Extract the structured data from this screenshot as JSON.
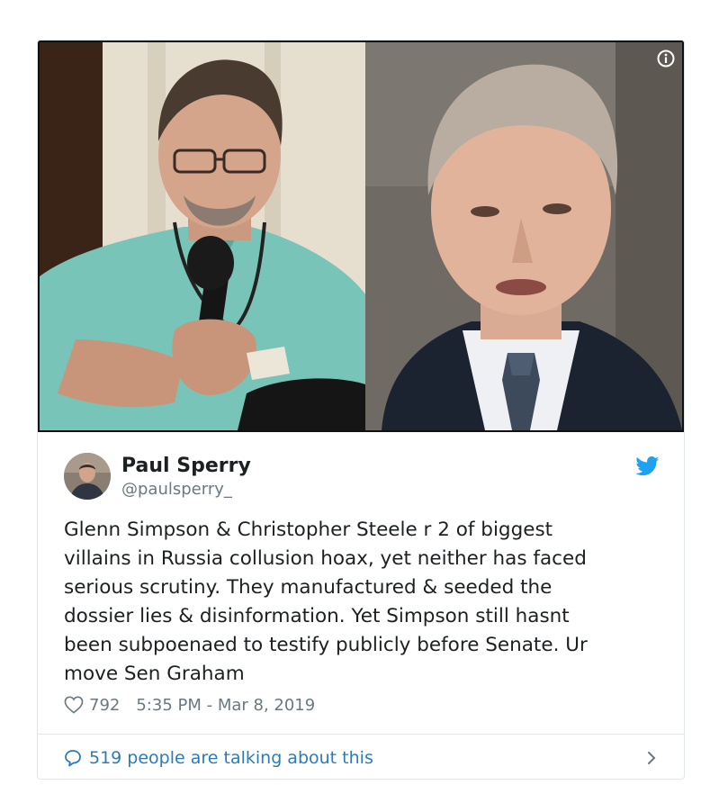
{
  "tweet": {
    "author_name": "Paul Sperry",
    "author_handle": "@paulsperry_",
    "text": "Glenn Simpson & Christopher Steele r 2 of biggest\nvillains in Russia collusion hoax, yet neither has faced\nserious scrutiny. They manufactured & seeded the\ndossier lies & disinformation. Yet Simpson still hasnt\nbeen subpoenaed to testify publicly before Senate. Ur\nmove Sen Graham",
    "likes": "792",
    "timestamp": "5:35 PM - Mar 8, 2019",
    "talking": "519 people are talking about this"
  },
  "icons": {
    "info": "info-icon",
    "bird": "twitter-bird-icon",
    "heart": "heart-icon",
    "bubble": "reply-bubble-icon",
    "chevron": "chevron-right-icon"
  },
  "colors": {
    "accent": "#1da1f2",
    "link": "#2b7bb9",
    "muted": "#697882",
    "border": "#e1e8ed"
  }
}
